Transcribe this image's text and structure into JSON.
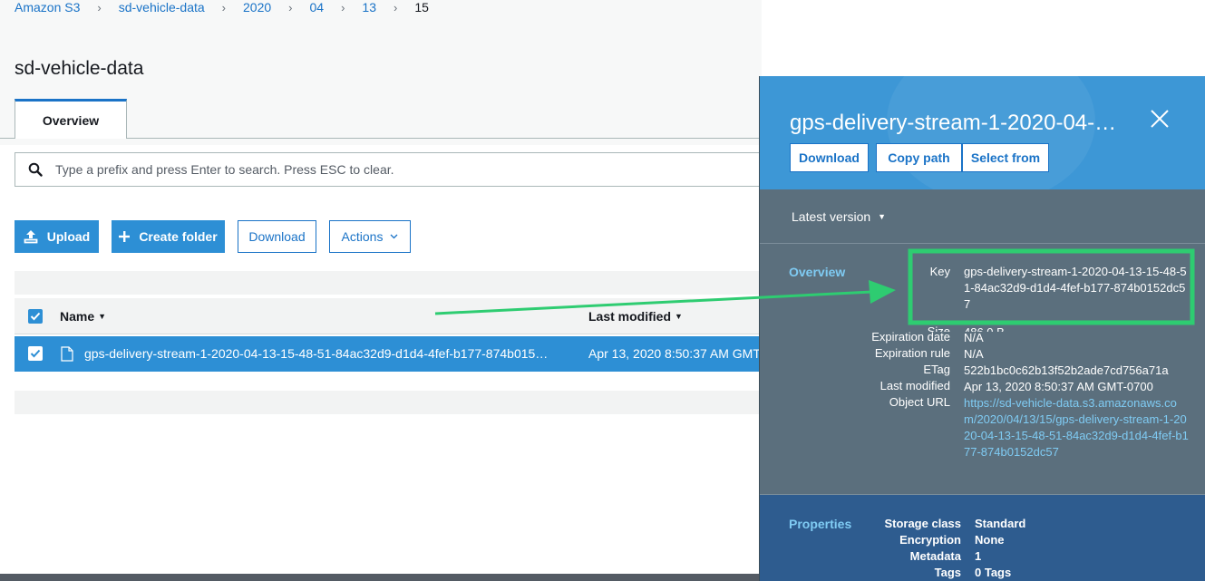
{
  "breadcrumb": {
    "items": [
      "Amazon S3",
      "sd-vehicle-data",
      "2020",
      "04",
      "13"
    ],
    "current": "15",
    "separator": "›"
  },
  "page": {
    "title": "sd-vehicle-data"
  },
  "tabs": [
    {
      "label": "Overview"
    }
  ],
  "search": {
    "placeholder": "Type a prefix and press Enter to search. Press ESC to clear.",
    "value": ""
  },
  "toolbar": {
    "upload_label": "Upload",
    "create_folder_label": "Create folder",
    "download_label": "Download",
    "actions_label": "Actions"
  },
  "table": {
    "columns": [
      "Name",
      "Last modified"
    ],
    "rows": [
      {
        "name": "gps-delivery-stream-1-2020-04-13-15-48-51-84ac32d9-d1d4-4fef-b177-874b015…",
        "last_modified": "Apr 13, 2020 8:50:37 AM GMT"
      }
    ]
  },
  "panel": {
    "title": "gps-delivery-stream-1-2020-04-…",
    "buttons": [
      "Download",
      "Copy path",
      "Select from"
    ],
    "version_label": "Latest version",
    "overview_label": "Overview",
    "overview": {
      "key_label": "Key",
      "key_value": "gps-delivery-stream-1-2020-04-13-15-48-51-84ac32d9-d1d4-4fef-b177-874b0152dc57",
      "size_label": "Size",
      "size_value": "486.0 B",
      "expiration_date_label": "Expiration date",
      "expiration_date_value": "N/A",
      "expiration_rule_label": "Expiration rule",
      "expiration_rule_value": "N/A",
      "etag_label": "ETag",
      "etag_value": "522b1bc0c62b13f52b2ade7cd756a71a",
      "last_modified_label": "Last modified",
      "last_modified_value": "Apr 13, 2020 8:50:37 AM GMT-0700",
      "object_url_label": "Object URL",
      "object_url_value": "https://sd-vehicle-data.s3.amazonaws.com/2020/04/13/15/gps-delivery-stream-1-2020-04-13-15-48-51-84ac32d9-d1d4-4fef-b177-874b0152dc57"
    },
    "properties_label": "Properties",
    "properties": {
      "storage_class_label": "Storage class",
      "storage_class_value": "Standard",
      "encryption_label": "Encryption",
      "encryption_value": "None",
      "metadata_label": "Metadata",
      "metadata_value": "1",
      "tags_label": "Tags",
      "tags_value": "0 Tags"
    }
  },
  "colors": {
    "accent": "#2d8fd5",
    "link": "#1a73c7",
    "highlight_green": "#2ecc71",
    "panel_bg": "#5b6f7d",
    "panel_header": "#3d97d6",
    "properties_bg": "#2e5c8f"
  }
}
